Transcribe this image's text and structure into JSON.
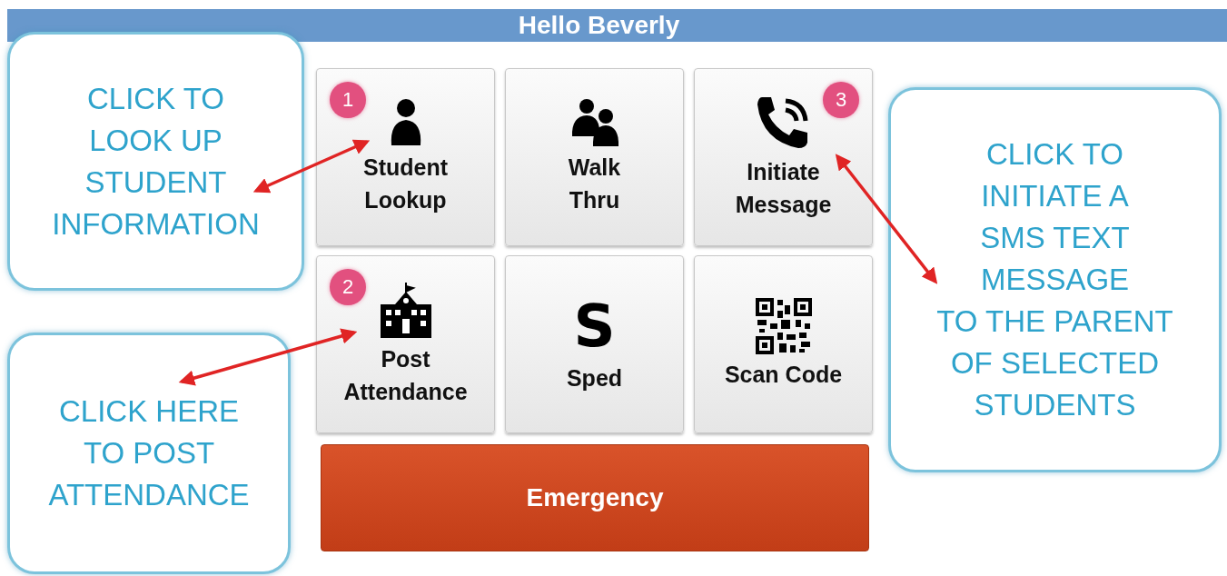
{
  "header": {
    "title": "Hello Beverly"
  },
  "tiles": [
    {
      "lines": [
        "Student",
        "Lookup"
      ],
      "kind": "person",
      "badge": "1"
    },
    {
      "lines": [
        "Walk",
        "Thru"
      ],
      "kind": "people"
    },
    {
      "lines": [
        "Initiate",
        "Message"
      ],
      "kind": "phone",
      "badge": "3"
    },
    {
      "lines": [
        "Post",
        "Attendance"
      ],
      "kind": "school",
      "badge": "2"
    },
    {
      "lines": [
        "Sped"
      ],
      "kind": "letter",
      "glyph": "S"
    },
    {
      "lines": [
        "Scan Code"
      ],
      "kind": "qr"
    }
  ],
  "emergency_button": {
    "label": "Emergency"
  },
  "callouts": [
    {
      "lines": [
        "CLICK TO",
        "LOOK UP",
        "STUDENT",
        "INFORMATION"
      ]
    },
    {
      "lines": [
        "CLICK HERE",
        "TO POST",
        "ATTENDANCE"
      ]
    },
    {
      "lines": [
        "CLICK TO",
        "INITIATE A",
        "SMS TEXT",
        "MESSAGE",
        "TO THE PARENT",
        "OF SELECTED",
        "STUDENTS"
      ]
    }
  ]
}
